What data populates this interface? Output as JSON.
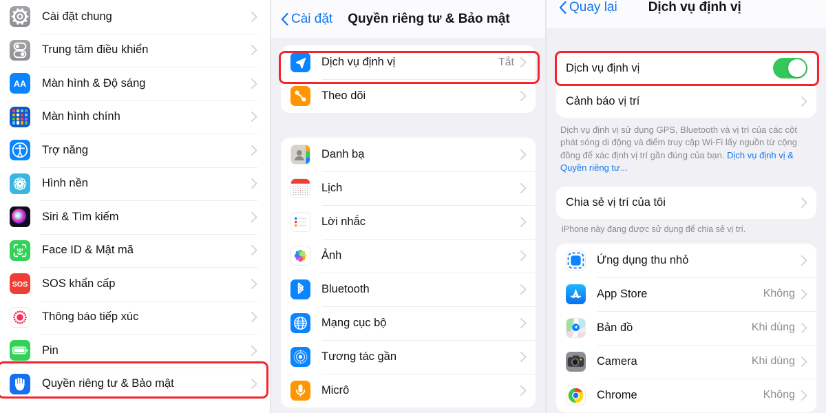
{
  "colors": {
    "accent_blue": "#1276f0",
    "toggle_green": "#34c759",
    "highlight_red": "#f5232c",
    "page_bg": "#f1f1f5",
    "card_bg": "#ffffff",
    "value_gray": "#8b8b91"
  },
  "sidebar": {
    "items": [
      {
        "label": "Cài đặt chung",
        "icon": "gear-icon"
      },
      {
        "label": "Trung tâm điều khiển",
        "icon": "control-center-icon"
      },
      {
        "label": "Màn hình & Độ sáng",
        "icon": "display-brightness-icon"
      },
      {
        "label": "Màn hình chính",
        "icon": "home-screen-icon"
      },
      {
        "label": "Trợ năng",
        "icon": "accessibility-icon"
      },
      {
        "label": "Hình nền",
        "icon": "wallpaper-icon"
      },
      {
        "label": "Siri & Tìm kiếm",
        "icon": "siri-icon"
      },
      {
        "label": "Face ID & Mật mã",
        "icon": "face-id-icon"
      },
      {
        "label": "SOS khẩn cấp",
        "icon": "sos-icon"
      },
      {
        "label": "Thông báo tiếp xúc",
        "icon": "exposure-notification-icon"
      },
      {
        "label": "Pin",
        "icon": "battery-icon"
      },
      {
        "label": "Quyền riêng tư & Bảo mật",
        "icon": "privacy-hand-icon",
        "highlighted": true
      }
    ]
  },
  "middle": {
    "back_label": "Cài đặt",
    "title": "Quyền riêng tư & Bảo mật",
    "group_top": [
      {
        "label": "Dịch vụ định vị",
        "value": "Tắt",
        "icon": "location-arrow-icon",
        "highlighted": true
      },
      {
        "label": "Theo dõi",
        "value": "",
        "icon": "tracking-icon"
      }
    ],
    "group_apps": [
      {
        "label": "Danh bạ",
        "value": "",
        "icon": "contacts-icon"
      },
      {
        "label": "Lịch",
        "value": "",
        "icon": "calendar-icon"
      },
      {
        "label": "Lời nhắc",
        "value": "",
        "icon": "reminders-icon"
      },
      {
        "label": "Ảnh",
        "value": "",
        "icon": "photos-icon"
      },
      {
        "label": "Bluetooth",
        "value": "",
        "icon": "bluetooth-icon"
      },
      {
        "label": "Mạng cục bộ",
        "value": "",
        "icon": "local-network-icon"
      },
      {
        "label": "Tương tác gần",
        "value": "",
        "icon": "nearby-interactions-icon"
      },
      {
        "label": "Micrô",
        "value": "",
        "icon": "microphone-icon"
      }
    ]
  },
  "right": {
    "back_label": "Quay lại",
    "title": "Dịch vụ định vị",
    "toggle_row": {
      "label": "Dịch vụ định vị",
      "state": "on",
      "highlighted": true
    },
    "alerts_row": {
      "label": "Cảnh báo vị trí"
    },
    "description": "Dịch vụ định vị sử dụng GPS, Bluetooth và vị trí của các cột phát sóng di động và điểm truy cập Wi-Fi lấy nguồn từ cộng đồng để xác định vị trí gần đúng của bạn. ",
    "description_link": "Dịch vụ định vị & Quyền riêng tư...",
    "share_row": {
      "label": "Chia sẻ vị trí của tôi"
    },
    "share_note": "iPhone này đang được sử dụng để chia sẻ vị trí.",
    "apps": [
      {
        "label": "Ứng dụng thu nhỏ",
        "value": "",
        "icon": "app-clips-icon"
      },
      {
        "label": "App Store",
        "value": "Không",
        "icon": "app-store-icon"
      },
      {
        "label": "Bản đồ",
        "value": "Khi dùng",
        "icon": "maps-icon"
      },
      {
        "label": "Camera",
        "value": "Khi dùng",
        "icon": "camera-icon"
      },
      {
        "label": "Chrome",
        "value": "Không",
        "icon": "chrome-icon"
      }
    ]
  }
}
